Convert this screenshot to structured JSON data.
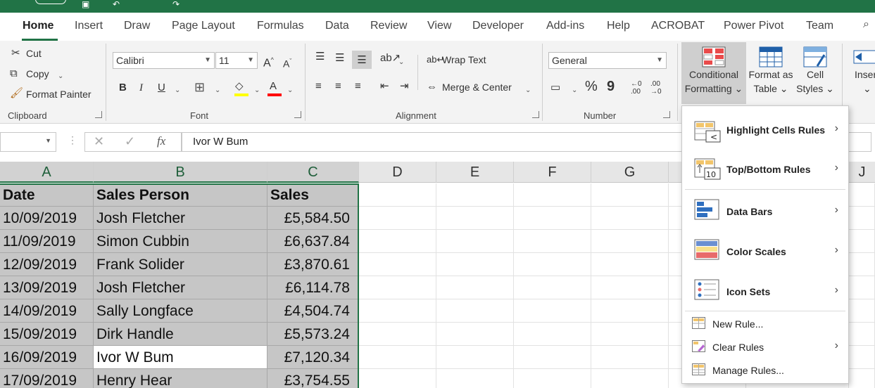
{
  "ribbon_tabs": [
    "Home",
    "Insert",
    "Draw",
    "Page Layout",
    "Formulas",
    "Data",
    "Review",
    "View",
    "Developer",
    "Add-ins",
    "Help",
    "ACROBAT",
    "Power Pivot",
    "Team"
  ],
  "clipboard": {
    "cut": "Cut",
    "copy": "Copy",
    "format_painter": "Format Painter",
    "label": "Clipboard"
  },
  "font": {
    "name": "Calibri",
    "size": "11",
    "label": "Font",
    "bold": "B",
    "italic": "I",
    "underline": "U",
    "grow": "A",
    "shrink": "A",
    "fill_color": "#ffff00",
    "font_color": "#ff0000"
  },
  "alignment": {
    "wrap_text": "Wrap Text",
    "merge_center": "Merge & Center",
    "label": "Alignment"
  },
  "number": {
    "format": "General",
    "label": "Number",
    "percent": "%",
    "comma": "9",
    "inc_decimal": ".00",
    "dec_decimal": ".00"
  },
  "styles": {
    "conditional_formatting": [
      "Conditional",
      "Formatting"
    ],
    "format_as_table": [
      "Format as",
      "Table"
    ],
    "cell_styles": [
      "Cell",
      "Styles"
    ]
  },
  "cells": {
    "insert": "Inser"
  },
  "formula_bar": {
    "fx": "fx",
    "content": "Ivor W Bum"
  },
  "columns": [
    "A",
    "B",
    "C",
    "D",
    "E",
    "F",
    "G",
    "J"
  ],
  "table": {
    "headers": [
      "Date",
      "Sales Person",
      "Sales"
    ],
    "rows": [
      [
        "10/09/2019",
        "Josh Fletcher",
        "£5,584.50"
      ],
      [
        "11/09/2019",
        "Simon Cubbin",
        "£6,637.84"
      ],
      [
        "12/09/2019",
        "Frank Solider",
        "£3,870.61"
      ],
      [
        "13/09/2019",
        "Josh Fletcher",
        "£6,114.78"
      ],
      [
        "14/09/2019",
        "Sally Longface",
        "£4,504.74"
      ],
      [
        "15/09/2019",
        "Dirk Handle",
        "£5,573.24"
      ],
      [
        "16/09/2019",
        "Ivor W Bum",
        "£7,120.34"
      ],
      [
        "17/09/2019",
        "Henry Hear",
        "£3,754.55"
      ]
    ]
  },
  "cf_menu": {
    "items": [
      "Highlight Cells Rules",
      "Top/Bottom Rules",
      "Data Bars",
      "Color Scales",
      "Icon Sets"
    ],
    "actions": [
      "New Rule...",
      "Clear Rules",
      "Manage Rules..."
    ]
  },
  "colors": {
    "accent": "#217346",
    "selection_fill": "#c6c6c6"
  }
}
